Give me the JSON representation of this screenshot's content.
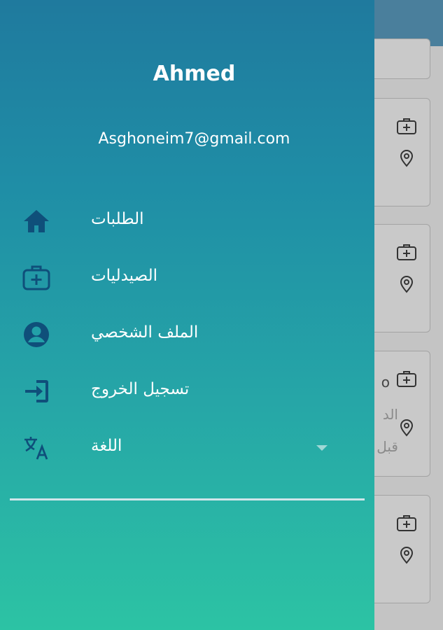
{
  "user": {
    "name": "Ahmed",
    "email": "Asghoneim7@gmail.com"
  },
  "menu": {
    "items": [
      {
        "label": "الطلبات",
        "icon": "home-icon"
      },
      {
        "label": "الصيدليات",
        "icon": "medical-kit-icon"
      },
      {
        "label": "الملف الشخصي",
        "icon": "account-circle-icon"
      },
      {
        "label": "تسجيل الخروج",
        "icon": "logout-icon"
      },
      {
        "label": "اللغة",
        "icon": "translate-icon"
      }
    ]
  },
  "background": {
    "card_partial_text_1": "o",
    "card_partial_text_2": "الد",
    "card_partial_text_3": "قبل"
  },
  "colors": {
    "drawer_top": "#1f7a9e",
    "drawer_bottom": "#2cc3a4",
    "icon": "#0f4f7a",
    "text": "#ffffff"
  }
}
